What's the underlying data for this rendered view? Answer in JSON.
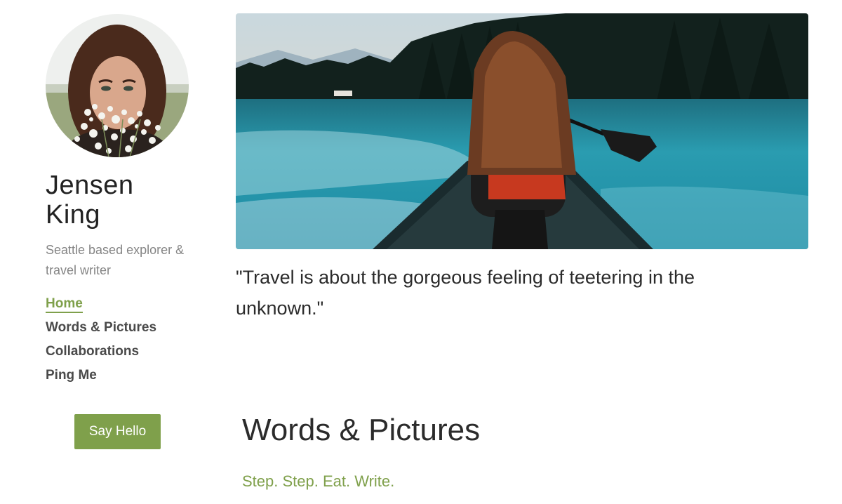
{
  "profile": {
    "name": "Jensen King",
    "tagline": "Seattle based explorer & travel writer"
  },
  "nav": {
    "items": [
      {
        "label": "Home",
        "active": true
      },
      {
        "label": "Words & Pictures",
        "active": false
      },
      {
        "label": "Collaborations",
        "active": false
      },
      {
        "label": "Ping Me",
        "active": false
      }
    ]
  },
  "cta": {
    "label": "Say Hello"
  },
  "main": {
    "quote": "\"Travel is about the gorgeous feeling of teetering in the unknown.\"",
    "section_title": "Words & Pictures",
    "section_subtitle": "Step. Step. Eat. Write."
  },
  "colors": {
    "accent": "#7fa04b",
    "text": "#2b2b2b",
    "muted": "#858585",
    "nav_text": "#4a4a4a"
  }
}
